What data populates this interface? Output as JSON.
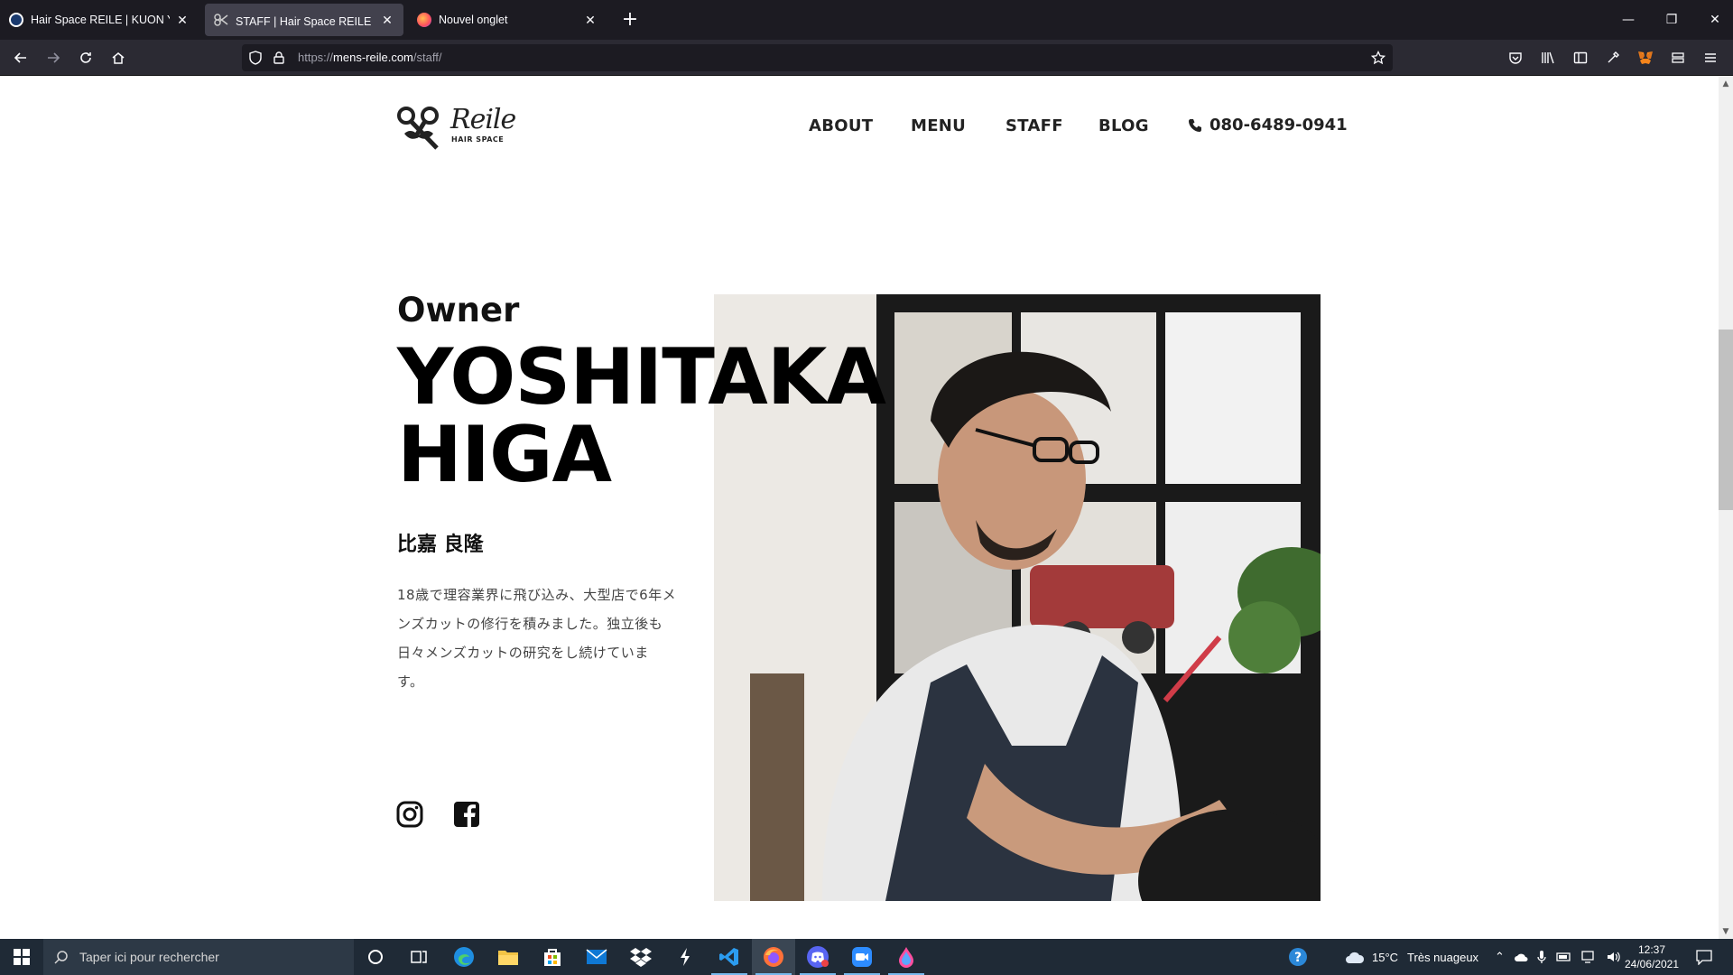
{
  "browser": {
    "tabs": [
      {
        "title": "Hair Space REILE | KUON YAGI P",
        "active": false
      },
      {
        "title": "STAFF | Hair Space REILE - ヘア",
        "active": true
      },
      {
        "title": "Nouvel onglet",
        "active": false
      }
    ],
    "url_prefix": "https://",
    "url_host": "mens-reile.com",
    "url_path": "/staff/"
  },
  "site": {
    "logo_text": "Reile",
    "logo_sub": "HAIR SPACE",
    "nav": [
      "ABOUT",
      "MENU",
      "STAFF",
      "BLOG"
    ],
    "phone": "080-6489-0941"
  },
  "staff": {
    "role": "Owner",
    "name": "YOSHITAKA\nHIGA",
    "name_jp": "比嘉 良隆",
    "bio_lines": [
      "18歳で理容業界に飛び込み、大型店で6年メ",
      "ンズカットの修行を積みました。独立後も",
      "日々メンズカットの研究をし続けていま",
      "す。"
    ]
  },
  "taskbar": {
    "search_placeholder": "Taper ici pour rechercher",
    "weather_temp": "15°C",
    "weather_desc": "Très nuageux",
    "time": "12:37",
    "date": "24/06/2021"
  }
}
